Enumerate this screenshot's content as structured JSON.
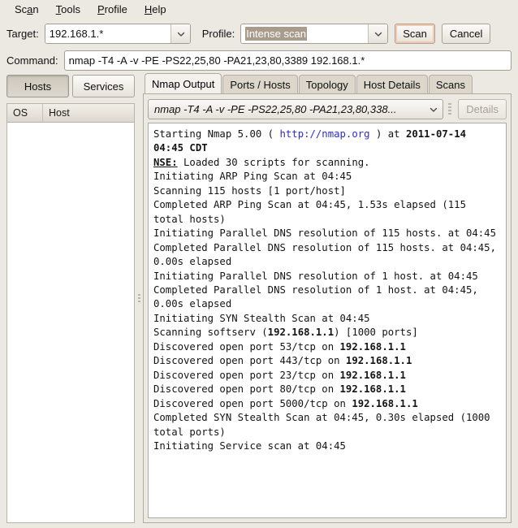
{
  "window": {
    "app_name": "Zenmap",
    "bg_color": "#ece9e3",
    "accent_color": "#a99c8d",
    "link_color": "#2b2bcf"
  },
  "menubar": {
    "items": [
      {
        "label": "Scan",
        "mnemonic": "a"
      },
      {
        "label": "Tools",
        "mnemonic": "T"
      },
      {
        "label": "Profile",
        "mnemonic": "P"
      },
      {
        "label": "Help",
        "mnemonic": "H"
      }
    ]
  },
  "toolbar": {
    "target_label": "Target:",
    "target_value": "192.168.1.*",
    "target_placeholder": "",
    "profile_label": "Profile:",
    "profile_value": "Intense scan",
    "profile_selected": true,
    "scan_button": "Scan",
    "cancel_button": "Cancel"
  },
  "command": {
    "label": "Command:",
    "value": "nmap -T4 -A -v -PE -PS22,25,80 -PA21,23,80,3389 192.168.1.*"
  },
  "sidebar": {
    "hosts_tab": "Hosts",
    "services_tab": "Services",
    "active_tab": "Hosts",
    "columns": [
      "OS",
      "Host"
    ],
    "rows": []
  },
  "main": {
    "tabs": [
      {
        "label": "Nmap Output",
        "active": true
      },
      {
        "label": "Ports / Hosts",
        "active": false
      },
      {
        "label": "Topology",
        "active": false
      },
      {
        "label": "Host Details",
        "active": false
      },
      {
        "label": "Scans",
        "active": false
      }
    ],
    "scan_selector_value": "nmap -T4 -A -v -PE -PS22,25,80 -PA21,23,80,338...",
    "details_button": "Details",
    "details_enabled": false,
    "output_lines": [
      "Starting Nmap 5.00 ( http://nmap.org ) at 2011-07-14 04:45 CDT",
      "NSE: Loaded 30 scripts for scanning.",
      "Initiating ARP Ping Scan at 04:45",
      "Scanning 115 hosts [1 port/host]",
      "Completed ARP Ping Scan at 04:45, 1.53s elapsed (115 total hosts)",
      "Initiating Parallel DNS resolution of 115 hosts. at 04:45",
      "Completed Parallel DNS resolution of 115 hosts. at 04:45, 0.00s elapsed",
      "Initiating Parallel DNS resolution of 1 host. at 04:45",
      "Completed Parallel DNS resolution of 1 host. at 04:45, 0.00s elapsed",
      "Initiating SYN Stealth Scan at 04:45",
      "Scanning softserv (192.168.1.1) [1000 ports]",
      "Discovered open port 53/tcp on 192.168.1.1",
      "Discovered open port 443/tcp on 192.168.1.1",
      "Discovered open port 23/tcp on 192.168.1.1",
      "Discovered open port 80/tcp on 192.168.1.1",
      "Discovered open port 5000/tcp on 192.168.1.1",
      "Completed SYN Stealth Scan at 04:45, 0.30s elapsed (1000 total ports)",
      "Initiating Service scan at 04:45"
    ],
    "output_html": "Starting Nmap 5.00 ( <span class=\"lnk\">http://nmap.org</span> ) at <b>2011-07-14 04:45 CDT</b>\n<span class=\"nse\">NSE:</span> Loaded 30 scripts for scanning.\nInitiating ARP Ping Scan at 04:45\nScanning 115 hosts [1 port/host]\nCompleted ARP Ping Scan at 04:45, 1.53s elapsed (115 total hosts)\nInitiating Parallel DNS resolution of 115 hosts. at 04:45\nCompleted Parallel DNS resolution of 115 hosts. at 04:45, 0.00s elapsed\nInitiating Parallel DNS resolution of 1 host. at 04:45\nCompleted Parallel DNS resolution of 1 host. at 04:45, 0.00s elapsed\nInitiating SYN Stealth Scan at 04:45\nScanning softserv (<b>192.168.1.1</b>) [1000 ports]\nDiscovered open port 53/tcp on <b>192.168.1.1</b>\nDiscovered open port 443/tcp on <b>192.168.1.1</b>\nDiscovered open port 23/tcp on <b>192.168.1.1</b>\nDiscovered open port 80/tcp on <b>192.168.1.1</b>\nDiscovered open port 5000/tcp on <b>192.168.1.1</b>\nCompleted SYN Stealth Scan at 04:45, 0.30s elapsed (1000 total ports)\nInitiating Service scan at 04:45",
    "scan_target_host": "softserv",
    "scan_target_ip": "192.168.1.1",
    "nmap_version": "5.00",
    "nmap_url": "http://nmap.org",
    "scan_timestamp": "2011-07-14 04:45 CDT",
    "open_ports": [
      "53/tcp",
      "443/tcp",
      "23/tcp",
      "80/tcp",
      "5000/tcp"
    ],
    "total_ports_scanned": "1000",
    "total_hosts": "115",
    "scripts_loaded": "30"
  }
}
